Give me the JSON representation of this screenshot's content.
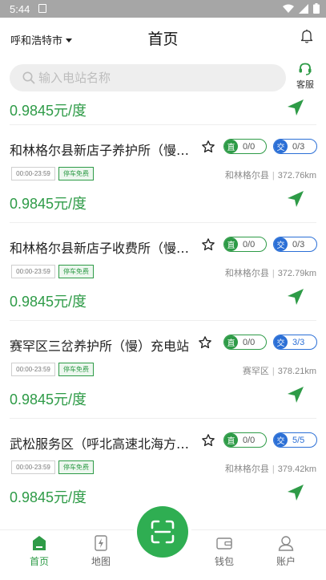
{
  "status_bar": {
    "time": "5:44"
  },
  "header": {
    "city": "呼和浩特市",
    "title": "首页"
  },
  "search": {
    "placeholder": "输入电站名称",
    "value": ""
  },
  "service": {
    "label": "客服"
  },
  "top_price": "0.9845元/度",
  "stations": [
    {
      "name": "和林格尔县新店子养护所（慢充电站",
      "dc": {
        "label": "直",
        "count": "0/0"
      },
      "ac": {
        "label": "交",
        "count": "0/3",
        "avail": "0"
      },
      "hours": "00:00-23:59",
      "parking": "停车免费",
      "district": "和林格尔县",
      "distance": "372.76km",
      "price": "0.9845元/度"
    },
    {
      "name": "和林格尔县新店子收费所（慢充电站",
      "dc": {
        "label": "直",
        "count": "0/0"
      },
      "ac": {
        "label": "交",
        "count": "0/3",
        "avail": "0"
      },
      "hours": "00:00-23:59",
      "parking": "停车免费",
      "district": "和林格尔县",
      "distance": "372.79km",
      "price": "0.9845元/度"
    },
    {
      "name": "赛罕区三岔养护所（慢）充电站",
      "dc": {
        "label": "直",
        "count": "0/0"
      },
      "ac": {
        "label": "交",
        "count": "3/3",
        "avail": "3"
      },
      "hours": "00:00-23:59",
      "parking": "停车免费",
      "district": "赛罕区",
      "distance": "378.21km",
      "price": "0.9845元/度"
    },
    {
      "name": "武松服务区（呼北高速北海方向充电站",
      "dc": {
        "label": "直",
        "count": "0/0"
      },
      "ac": {
        "label": "交",
        "count": "5/5",
        "avail": "5"
      },
      "hours": "00:00-23:59",
      "parking": "停车免费",
      "district": "和林格尔县",
      "distance": "379.42km",
      "price": "0.9845元/度"
    }
  ],
  "tabs": [
    {
      "label": "首页",
      "icon": "home-icon"
    },
    {
      "label": "地图",
      "icon": "map-icon"
    },
    {
      "label": "钱包",
      "icon": "wallet-icon"
    },
    {
      "label": "账户",
      "icon": "account-icon"
    }
  ],
  "colors": {
    "accent": "#2e9b47",
    "ac_blue": "#2b6fd6",
    "scan_green": "#2fae52"
  }
}
